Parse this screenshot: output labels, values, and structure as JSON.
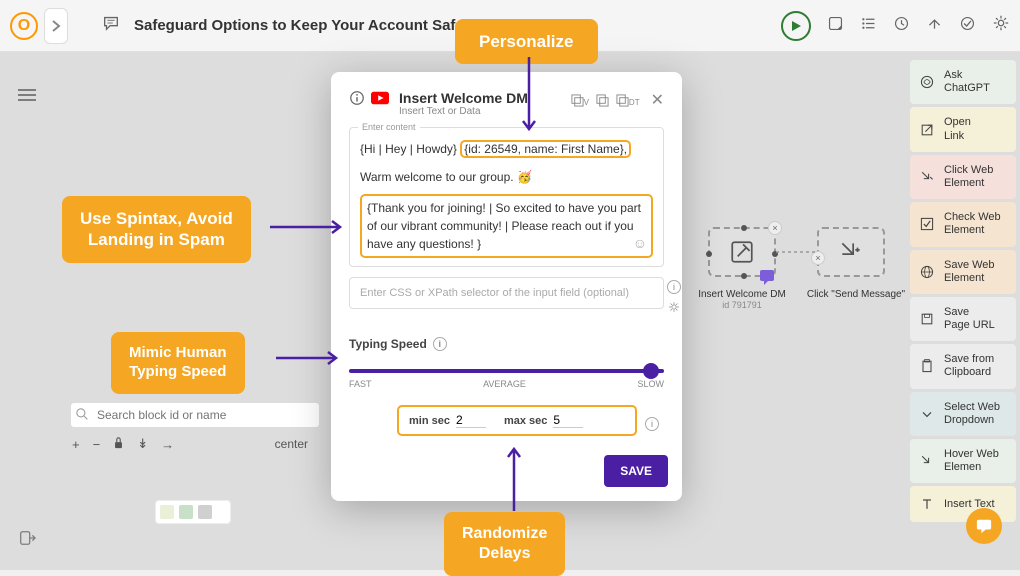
{
  "topbar": {
    "title": "Safeguard Options to Keep Your Account Safe"
  },
  "sidebar_right": [
    {
      "icon": "gpt",
      "label": "Ask\nChatGPT",
      "cls": "sb-green"
    },
    {
      "icon": "link",
      "label": "Open\nLink",
      "cls": "sb-yellow"
    },
    {
      "icon": "click",
      "label": "Click Web\nElement",
      "cls": "sb-pink"
    },
    {
      "icon": "check",
      "label": "Check Web\nElement",
      "cls": "sb-orange"
    },
    {
      "icon": "globe",
      "label": "Save Web\nElement",
      "cls": "sb-orange"
    },
    {
      "icon": "save",
      "label": "Save\nPage URL",
      "cls": "sb-grey"
    },
    {
      "icon": "clip",
      "label": "Save from\nClipboard",
      "cls": "sb-grey"
    },
    {
      "icon": "drop",
      "label": "Select Web\nDropdown",
      "cls": "sb-blue"
    },
    {
      "icon": "hover",
      "label": "Hover Web\nElemen",
      "cls": "sb-green"
    },
    {
      "icon": "text",
      "label": "Insert Text",
      "cls": "sb-yellow"
    }
  ],
  "nodes": {
    "a": {
      "label": "Insert Welcome DM",
      "sub": "id 791791"
    },
    "b": {
      "label": "Click \"Send Message\""
    }
  },
  "search": {
    "placeholder": "Search block id or name",
    "center": "center"
  },
  "modal": {
    "title": "Insert Welcome DM",
    "subtitle": "Insert Text or Data",
    "enter_label": "Enter content",
    "line1_prefix": "{Hi | Hey | Howdy}",
    "line1_pill": "{id: 26549, name: First Name},",
    "line2": "Warm welcome to our group. 🥳",
    "block2": "{Thank you for joining!  | So excited to have you part of our vibrant community! | Please reach out if you have any questions! }",
    "selector_placeholder": "Enter CSS or XPath selector of the input field (optional)",
    "typing_label": "Typing Speed",
    "fast": "FAST",
    "avg": "AVERAGE",
    "slow": "SLOW",
    "min_label": "min sec",
    "min_val": "2",
    "max_label": "max sec",
    "max_val": "5",
    "save": "SAVE",
    "dt": "DT",
    "v": "V"
  },
  "callouts": {
    "personalize": "Personalize",
    "spintax": "Use Spintax, Avoid\nLanding in Spam",
    "typing": "Mimic Human\nTyping Speed",
    "delays": "Randomize\nDelays"
  }
}
